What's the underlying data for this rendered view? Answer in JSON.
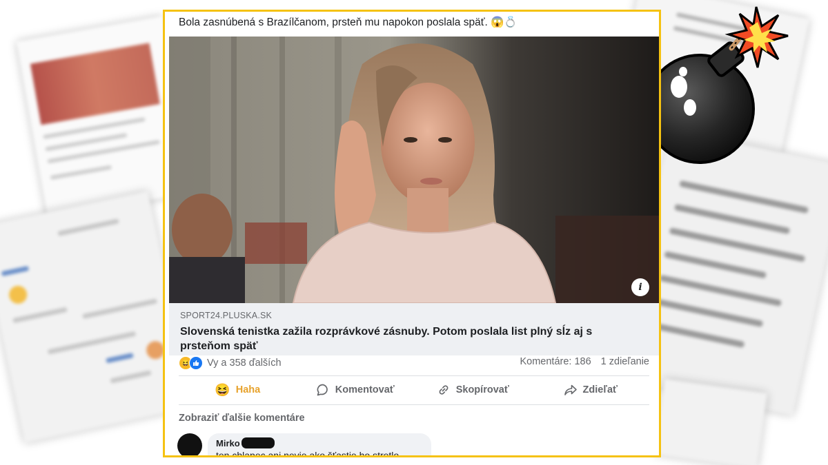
{
  "post": {
    "caption": "Bola zasnúbená s Brazílčanom, prsteň mu napokon poslala späť. 😱💍",
    "link": {
      "domain": "SPORT24.PLUSKA.SK",
      "headline": "Slovenská tenistka zažila rozprávkové zásnuby. Potom poslala list plný sĺz aj s prsteňom späť"
    },
    "info_icon": "i",
    "reactions": {
      "icons": [
        "haha-icon",
        "like-icon"
      ],
      "summary": "Vy a 358 ďalších",
      "comments": "Komentáre: 186",
      "shares": "1 zdieľanie"
    },
    "actions": [
      {
        "label": "Haha",
        "icon": "haha-icon"
      },
      {
        "label": "Komentovať",
        "icon": "comment-icon"
      },
      {
        "label": "Skopírovať",
        "icon": "link-icon"
      },
      {
        "label": "Zdieľať",
        "icon": "share-icon"
      }
    ],
    "more_comments": "Zobraziť ďalšie komentáre",
    "comment": {
      "author": "Mirko",
      "text": "ten chlapec ani nevie ako šťastie ho stretlo"
    }
  },
  "colors": {
    "frame": "#f5c211",
    "haha": "#e7a22c",
    "like": "#1877f2",
    "text_secondary": "#65676b"
  }
}
